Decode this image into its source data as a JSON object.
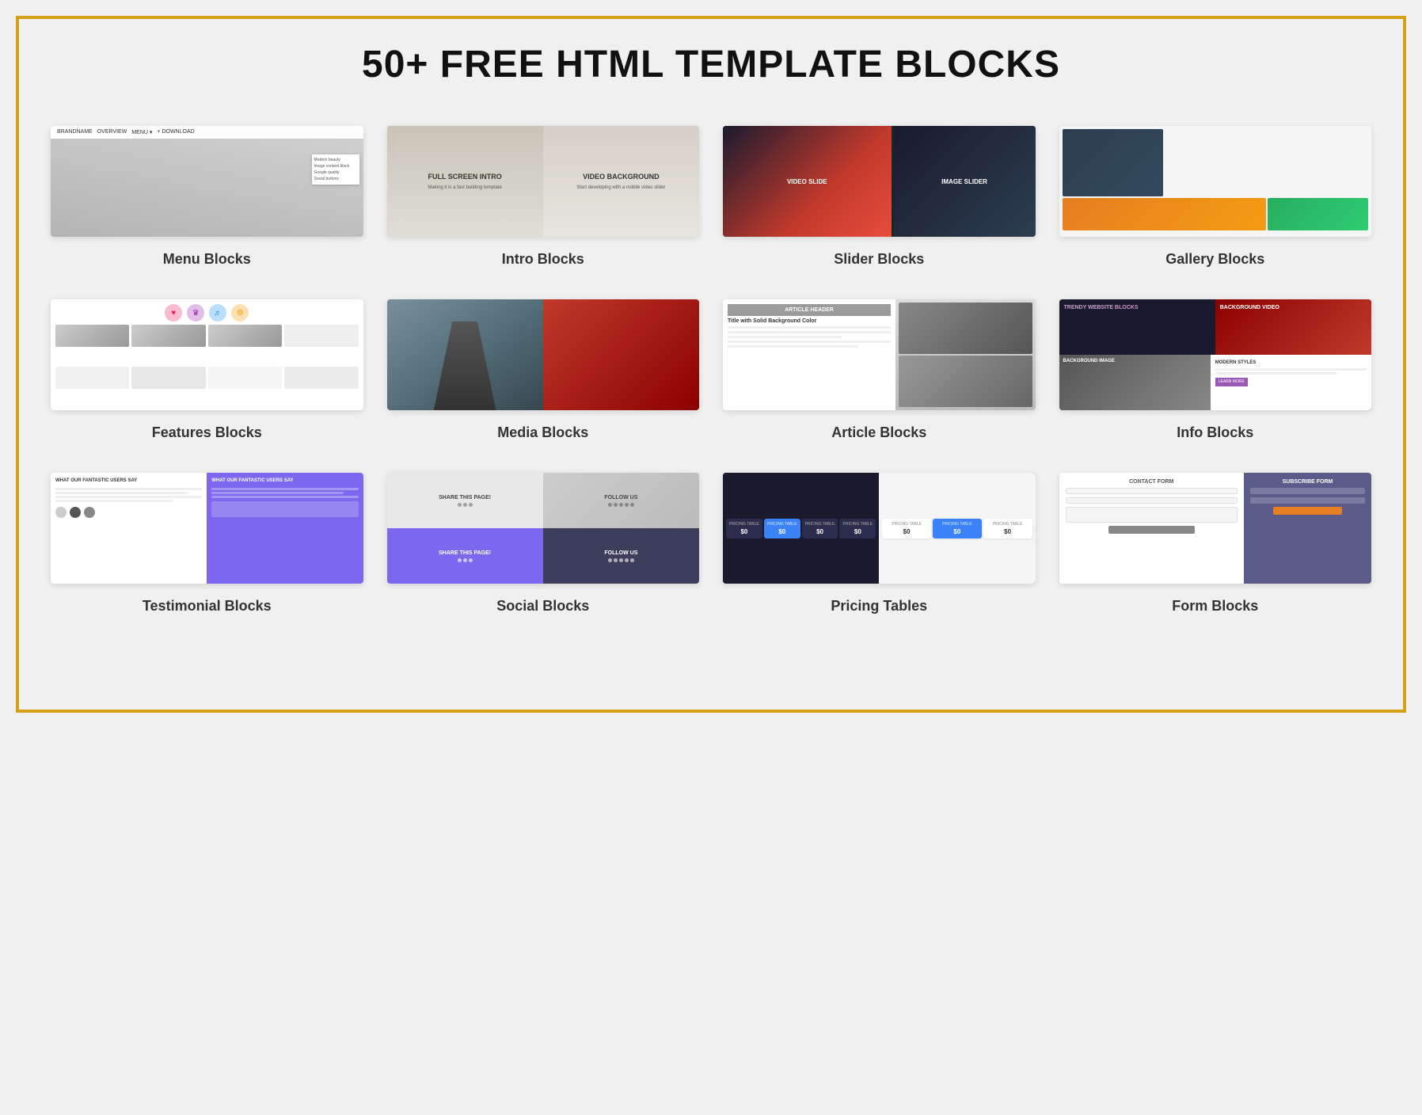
{
  "page": {
    "title": "50+ FREE HTML TEMPLATE BLOCKS",
    "border_color": "#d4a017"
  },
  "blocks": [
    {
      "id": "menu",
      "label": "Menu Blocks",
      "preview_type": "menu"
    },
    {
      "id": "intro",
      "label": "Intro Blocks",
      "preview_type": "intro",
      "left_title": "FULL SCREEN INTRO",
      "right_title": "VIDEO BACKGROUND"
    },
    {
      "id": "slider",
      "label": "Slider Blocks",
      "preview_type": "slider",
      "left_text": "VIDEO SLIDE",
      "right_text": "IMAGE SLIDER"
    },
    {
      "id": "gallery",
      "label": "Gallery Blocks",
      "preview_type": "gallery"
    },
    {
      "id": "features",
      "label": "Features Blocks",
      "preview_type": "features"
    },
    {
      "id": "media",
      "label": "Media Blocks",
      "preview_type": "media"
    },
    {
      "id": "article",
      "label": "Article Blocks",
      "preview_type": "article",
      "header_text": "ARTICLE HEADER",
      "title_text": "Title with Solid Background Color"
    },
    {
      "id": "info",
      "label": "Info Blocks",
      "preview_type": "info",
      "text1": "TRENDY WEBSITE BLOCKS",
      "text2": "BACKGROUND VIDEO",
      "text3": "BACKGROUND IMAGE",
      "text4": "MODERN STYLES"
    },
    {
      "id": "testimonial",
      "label": "Testimonial Blocks",
      "preview_type": "testimonial",
      "left_heading": "WHAT OUR FANTASTIC USERS SAY",
      "right_heading": "WHAT OUR FANTASTIC USERS SAY"
    },
    {
      "id": "social",
      "label": "Social Blocks",
      "preview_type": "social",
      "share_text": "SHARE THIS PAGE!",
      "follow_text": "FOLLOW US",
      "share_text2": "SHARE THIS PAGE!",
      "follow_text2": "FOLLOW US"
    },
    {
      "id": "pricing",
      "label": "Pricing Tables",
      "preview_type": "pricing",
      "table_label": "PRICING TABLE"
    },
    {
      "id": "form",
      "label": "Form Blocks",
      "preview_type": "form",
      "contact_label": "CONTACT FORM",
      "subscribe_label": "SUBSCRIBE FORM"
    }
  ]
}
